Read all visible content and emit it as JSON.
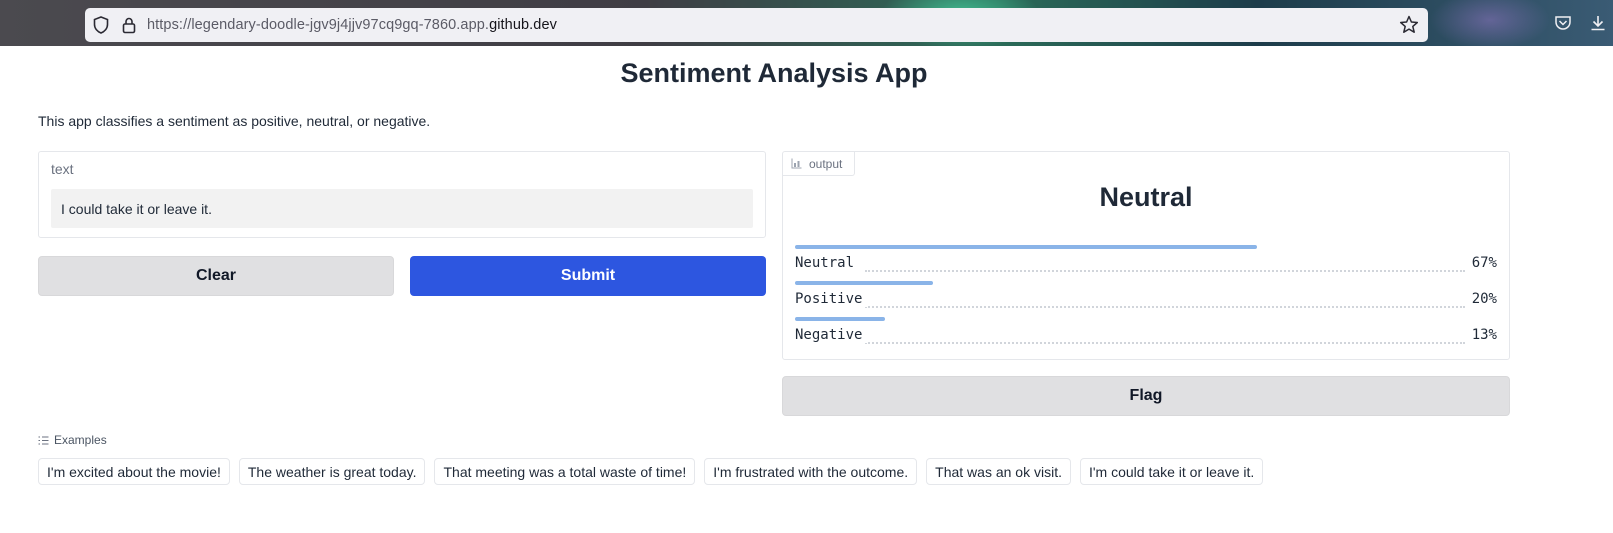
{
  "browser": {
    "url_prefix": "https://legendary-doodle-jgv9j4jjv97cq9gq-7860.app.",
    "url_host": "github.dev"
  },
  "app": {
    "title": "Sentiment Analysis App",
    "description": "This app classifies a sentiment as positive, neutral, or negative."
  },
  "input": {
    "label": "text",
    "value": "I could take it or leave it."
  },
  "buttons": {
    "clear": "Clear",
    "submit": "Submit",
    "flag": "Flag"
  },
  "output": {
    "tag": "output",
    "label": "Neutral",
    "confidences": [
      {
        "name": "Neutral",
        "percent_label": "67%",
        "fraction": 0.67
      },
      {
        "name": "Positive",
        "percent_label": "20%",
        "fraction": 0.2
      },
      {
        "name": "Negative",
        "percent_label": "13%",
        "fraction": 0.13
      }
    ]
  },
  "examples": {
    "heading": "Examples",
    "items": [
      "I'm excited about the movie!",
      "The weather is great today.",
      "That meeting was a total waste of time!",
      "I'm frustrated with the outcome.",
      "That was an ok visit.",
      "I'm could take it or leave it."
    ]
  },
  "colors": {
    "submit": "#2d56e0",
    "confidence_bar": "#8ab4e8",
    "secondary_button": "#e0e0e2"
  },
  "icons": [
    "shield-icon",
    "lock-icon",
    "star-icon",
    "pocket-icon",
    "download-icon",
    "chart-icon",
    "list-icon"
  ]
}
